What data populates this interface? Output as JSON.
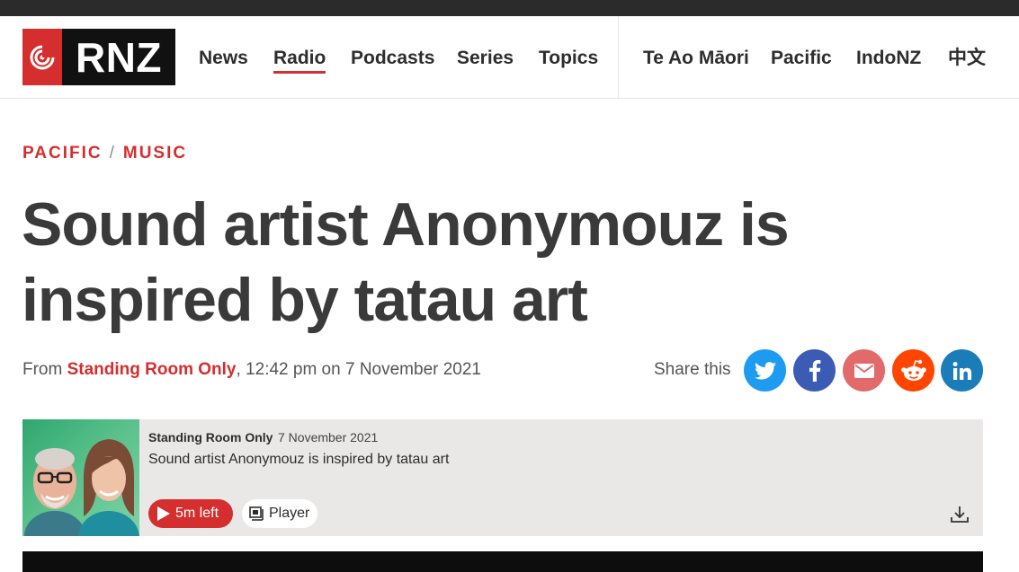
{
  "header": {
    "logo_text": "RNZ",
    "nav": [
      {
        "label": "News"
      },
      {
        "label": "Radio"
      },
      {
        "label": "Podcasts"
      },
      {
        "label": "Series"
      },
      {
        "label": "Topics"
      },
      {
        "label": "Te Ao Māori"
      },
      {
        "label": "Pacific"
      },
      {
        "label": "IndoNZ"
      },
      {
        "label": "中文"
      }
    ],
    "active_nav": "Radio"
  },
  "breadcrumb": {
    "section": "PACIFIC",
    "separator": "/",
    "subsection": "MUSIC"
  },
  "article": {
    "title": "Sound artist Anonymouz is inspired by tatau art",
    "byline_prefix": "From",
    "byline_source": "Standing Room Only",
    "byline_time": ", 12:42 pm on 7 November 2021"
  },
  "share": {
    "label": "Share this",
    "buttons": [
      {
        "name": "twitter",
        "icon": "twitter-icon",
        "color": "#1d9bf0"
      },
      {
        "name": "facebook",
        "icon": "facebook-icon",
        "color": "#3b5bb5"
      },
      {
        "name": "email",
        "icon": "email-icon",
        "color": "#e36a6a"
      },
      {
        "name": "reddit",
        "icon": "reddit-icon",
        "color": "#ff4500"
      },
      {
        "name": "linkedin",
        "icon": "linkedin-icon",
        "color": "#1a7cb8"
      }
    ]
  },
  "player": {
    "program": "Standing Room Only",
    "date": "7 November 2021",
    "title": "Sound artist Anonymouz is inspired by tatau art",
    "play_label": "5m left",
    "player_label": "Player"
  },
  "colors": {
    "brand_red": "#d42e2e",
    "text_dark": "#3a3a3a",
    "player_bg": "#e9e8e6"
  }
}
